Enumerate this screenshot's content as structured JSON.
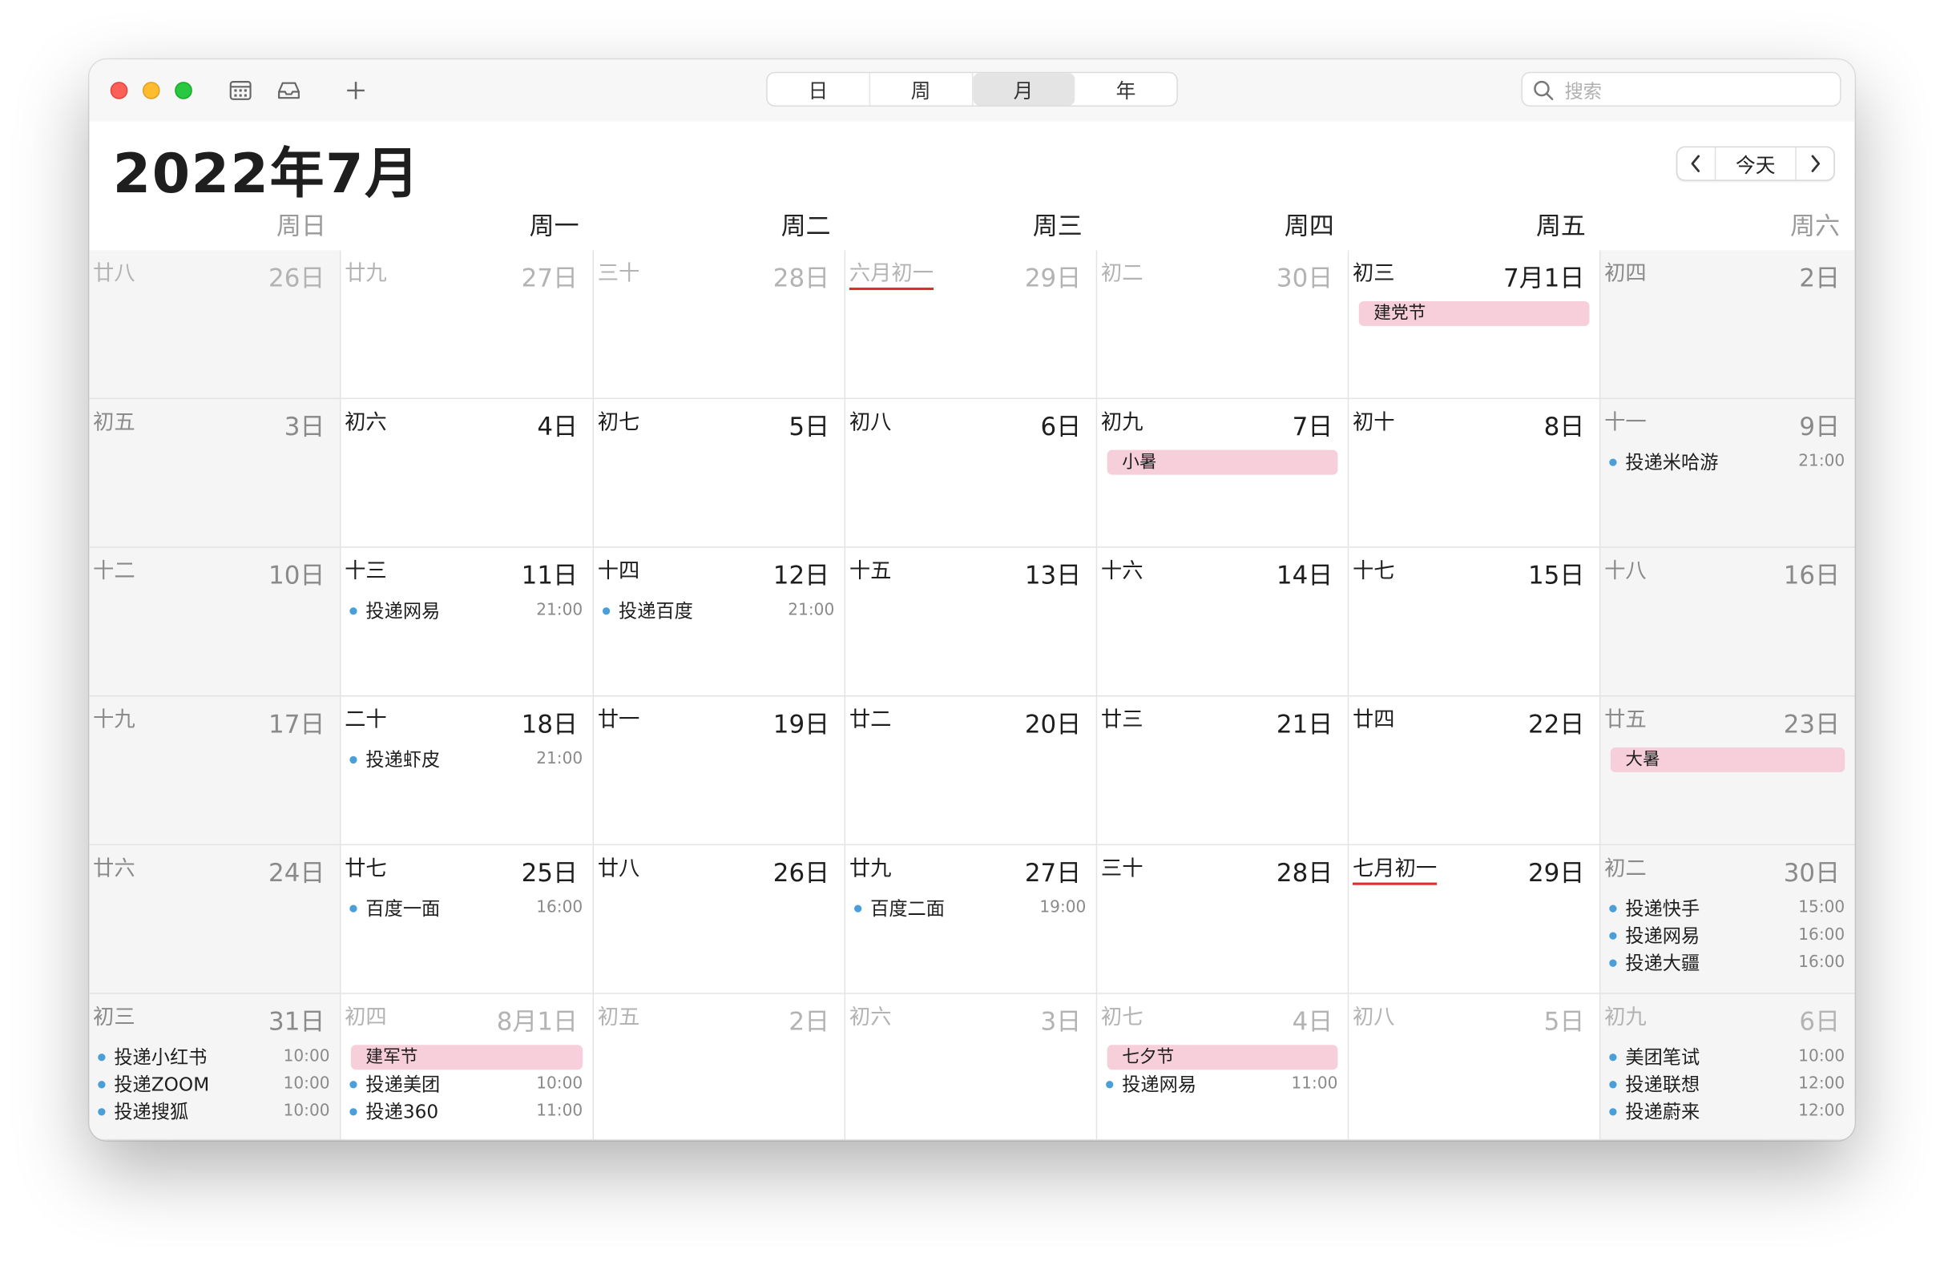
{
  "toolbar": {
    "calendar_icon": "calendar-list-icon",
    "inbox_icon": "inbox-icon",
    "add_icon": "plus-icon",
    "views": [
      "日",
      "周",
      "月",
      "年"
    ],
    "active_view": "月",
    "search_placeholder": "搜索"
  },
  "header": {
    "title": "2022年7月",
    "prev_label": "‹",
    "today_label": "今天",
    "next_label": "›"
  },
  "weekdays": [
    "周日",
    "周一",
    "周二",
    "周三",
    "周四",
    "周五",
    "周六"
  ],
  "weeks": [
    [
      {
        "lunar": "廿八",
        "date": "26日",
        "out": true
      },
      {
        "lunar": "廿九",
        "date": "27日",
        "out": true
      },
      {
        "lunar": "三十",
        "date": "28日",
        "out": true
      },
      {
        "lunar": "六月初一",
        "date": "29日",
        "out": true,
        "month_start": true
      },
      {
        "lunar": "初二",
        "date": "30日",
        "out": true
      },
      {
        "lunar": "初三",
        "date": "7月1日",
        "allday": [
          "建党节"
        ]
      },
      {
        "lunar": "初四",
        "date": "2日"
      }
    ],
    [
      {
        "lunar": "初五",
        "date": "3日"
      },
      {
        "lunar": "初六",
        "date": "4日"
      },
      {
        "lunar": "初七",
        "date": "5日"
      },
      {
        "lunar": "初八",
        "date": "6日"
      },
      {
        "lunar": "初九",
        "date": "7日",
        "allday": [
          "小暑"
        ]
      },
      {
        "lunar": "初十",
        "date": "8日"
      },
      {
        "lunar": "十一",
        "date": "9日",
        "events": [
          {
            "title": "投递米哈游",
            "time": "21:00"
          }
        ]
      }
    ],
    [
      {
        "lunar": "十二",
        "date": "10日"
      },
      {
        "lunar": "十三",
        "date": "11日",
        "events": [
          {
            "title": "投递网易",
            "time": "21:00"
          }
        ]
      },
      {
        "lunar": "十四",
        "date": "12日",
        "events": [
          {
            "title": "投递百度",
            "time": "21:00"
          }
        ]
      },
      {
        "lunar": "十五",
        "date": "13日"
      },
      {
        "lunar": "十六",
        "date": "14日"
      },
      {
        "lunar": "十七",
        "date": "15日"
      },
      {
        "lunar": "十八",
        "date": "16日"
      }
    ],
    [
      {
        "lunar": "十九",
        "date": "17日"
      },
      {
        "lunar": "二十",
        "date": "18日",
        "events": [
          {
            "title": "投递虾皮",
            "time": "21:00"
          }
        ]
      },
      {
        "lunar": "廿一",
        "date": "19日"
      },
      {
        "lunar": "廿二",
        "date": "20日"
      },
      {
        "lunar": "廿三",
        "date": "21日"
      },
      {
        "lunar": "廿四",
        "date": "22日"
      },
      {
        "lunar": "廿五",
        "date": "23日",
        "allday": [
          "大暑"
        ]
      }
    ],
    [
      {
        "lunar": "廿六",
        "date": "24日"
      },
      {
        "lunar": "廿七",
        "date": "25日",
        "events": [
          {
            "title": "百度一面",
            "time": "16:00"
          }
        ]
      },
      {
        "lunar": "廿八",
        "date": "26日"
      },
      {
        "lunar": "廿九",
        "date": "27日",
        "events": [
          {
            "title": "百度二面",
            "time": "19:00"
          }
        ]
      },
      {
        "lunar": "三十",
        "date": "28日"
      },
      {
        "lunar": "七月初一",
        "date": "29日",
        "month_start": true
      },
      {
        "lunar": "初二",
        "date": "30日",
        "events": [
          {
            "title": "投递快手",
            "time": "15:00"
          },
          {
            "title": "投递网易",
            "time": "16:00"
          },
          {
            "title": "投递大疆",
            "time": "16:00"
          }
        ]
      }
    ],
    [
      {
        "lunar": "初三",
        "date": "31日",
        "events": [
          {
            "title": "投递小红书",
            "time": "10:00"
          },
          {
            "title": "投递ZOOM",
            "time": "10:00"
          },
          {
            "title": "投递搜狐",
            "time": "10:00"
          }
        ]
      },
      {
        "lunar": "初四",
        "date": "8月1日",
        "out": true,
        "allday": [
          "建军节"
        ],
        "events": [
          {
            "title": "投递美团",
            "time": "10:00"
          },
          {
            "title": "投递360",
            "time": "11:00"
          }
        ]
      },
      {
        "lunar": "初五",
        "date": "2日",
        "out": true
      },
      {
        "lunar": "初六",
        "date": "3日",
        "out": true
      },
      {
        "lunar": "初七",
        "date": "4日",
        "out": true,
        "allday": [
          "七夕节"
        ],
        "events": [
          {
            "title": "投递网易",
            "time": "11:00"
          }
        ]
      },
      {
        "lunar": "初八",
        "date": "5日",
        "out": true
      },
      {
        "lunar": "初九",
        "date": "6日",
        "out": true,
        "events": [
          {
            "title": "美团笔试",
            "time": "10:00"
          },
          {
            "title": "投递联想",
            "time": "12:00"
          },
          {
            "title": "投递蔚来",
            "time": "12:00"
          }
        ]
      }
    ]
  ],
  "colors": {
    "holiday_bg": "#f6cfdb",
    "event_dot": "#4a9fd8",
    "month_start_underline": "#d9302b"
  }
}
